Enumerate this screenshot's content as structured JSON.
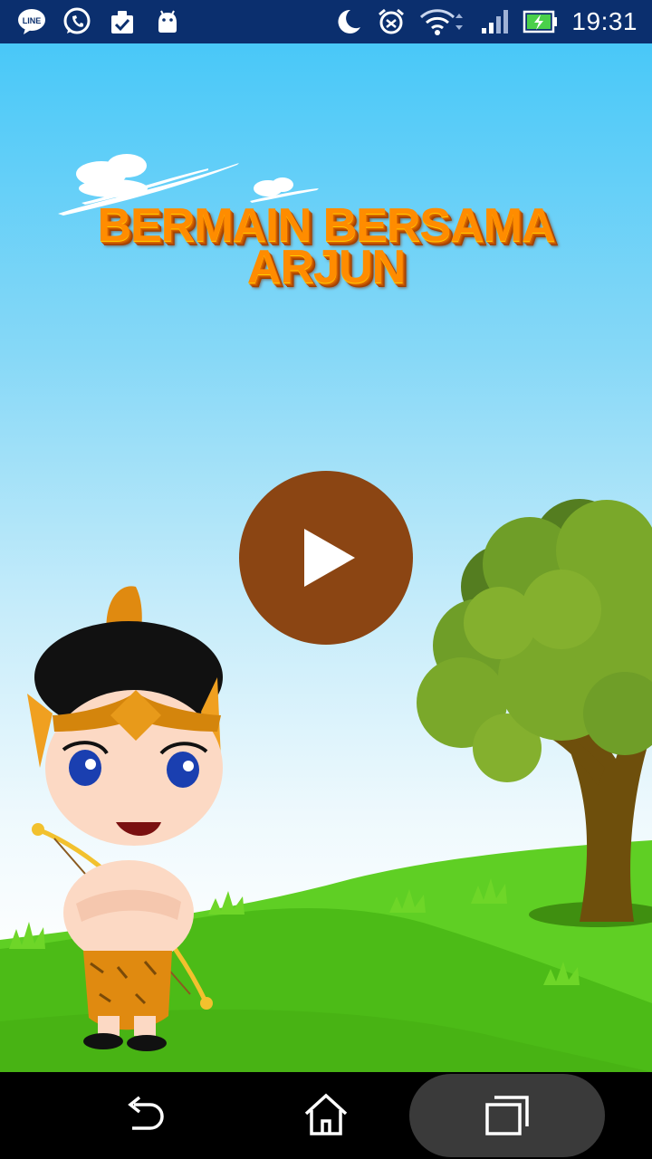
{
  "status_bar": {
    "time": "19:31",
    "notification_icons": [
      "line-icon",
      "whatsapp-icon",
      "clipboard-check-icon",
      "android-icon"
    ],
    "system_icons": [
      "moon-icon",
      "alarm-icon",
      "wifi-icon",
      "signal-icon",
      "battery-charging-icon"
    ]
  },
  "game": {
    "title_line1": "BERMAIN BERSAMA",
    "title_line2": "ARJUN",
    "play_icon": "play-icon",
    "colors": {
      "title": "#ff8c00",
      "play_button": "#8b4513",
      "grass": "#4cbb17",
      "sky_top": "#49c8f8"
    }
  },
  "nav_bar": {
    "icons": [
      "back-icon",
      "home-icon",
      "recent-apps-icon"
    ]
  }
}
